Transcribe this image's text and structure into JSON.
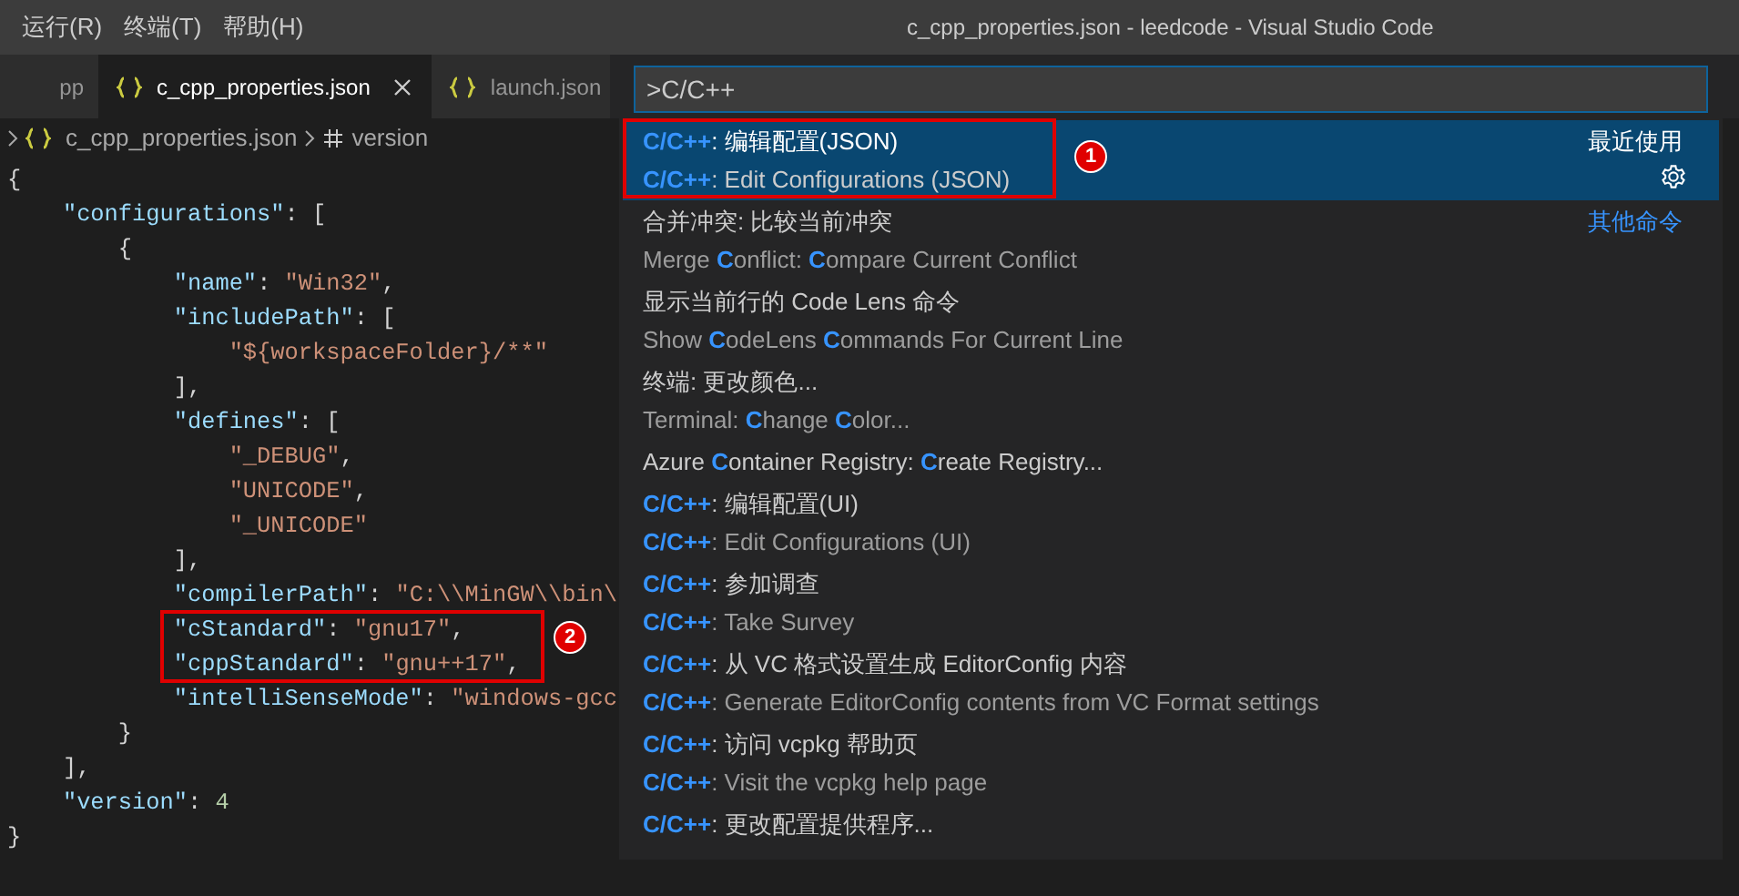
{
  "menu": [
    "运行(R)",
    "终端(T)",
    "帮助(H)"
  ],
  "window": {
    "title": "c_cpp_properties.json - leedcode - Visual Studio Code"
  },
  "tabs": [
    {
      "label": "pp",
      "selected": false,
      "closable": false
    },
    {
      "label": "c_cpp_properties.json",
      "selected": true,
      "closable": true
    },
    {
      "label": "launch.json",
      "selected": false,
      "closable": false
    }
  ],
  "breadcrumb": {
    "file": "c_cpp_properties.json",
    "symbol": "version"
  },
  "editor": {
    "callout": "2",
    "lines": [
      [
        {
          "kind": "punct",
          "text": "{"
        }
      ],
      [
        {
          "kind": "key",
          "text": "    \"configurations\""
        },
        {
          "kind": "punct",
          "text": ": ["
        }
      ],
      [
        {
          "kind": "punct",
          "text": "        {"
        }
      ],
      [
        {
          "kind": "key",
          "text": "            \"name\""
        },
        {
          "kind": "punct",
          "text": ": "
        },
        {
          "kind": "string",
          "text": "\"Win32\""
        },
        {
          "kind": "punct",
          "text": ","
        }
      ],
      [
        {
          "kind": "key",
          "text": "            \"includePath\""
        },
        {
          "kind": "punct",
          "text": ": ["
        }
      ],
      [
        {
          "kind": "string",
          "text": "                \"${workspaceFolder}/**\""
        }
      ],
      [
        {
          "kind": "punct",
          "text": "            ],"
        }
      ],
      [
        {
          "kind": "key",
          "text": "            \"defines\""
        },
        {
          "kind": "punct",
          "text": ": ["
        }
      ],
      [
        {
          "kind": "string",
          "text": "                \"_DEBUG\""
        },
        {
          "kind": "punct",
          "text": ","
        }
      ],
      [
        {
          "kind": "string",
          "text": "                \"UNICODE\""
        },
        {
          "kind": "punct",
          "text": ","
        }
      ],
      [
        {
          "kind": "string",
          "text": "                \"_UNICODE\""
        }
      ],
      [
        {
          "kind": "punct",
          "text": "            ],"
        }
      ],
      [
        {
          "kind": "key",
          "text": "            \"compilerPath\""
        },
        {
          "kind": "punct",
          "text": ": "
        },
        {
          "kind": "string",
          "text": "\"C:\\\\MinGW\\\\bin\\"
        }
      ],
      [
        {
          "kind": "key",
          "text": "            \"cStandard\""
        },
        {
          "kind": "punct",
          "text": ": "
        },
        {
          "kind": "string",
          "text": "\"gnu17\""
        },
        {
          "kind": "punct",
          "text": ","
        }
      ],
      [
        {
          "kind": "key",
          "text": "            \"cppStandard\""
        },
        {
          "kind": "punct",
          "text": ": "
        },
        {
          "kind": "string",
          "text": "\"gnu++17\""
        },
        {
          "kind": "punct",
          "text": ","
        }
      ],
      [
        {
          "kind": "key",
          "text": "            \"intelliSenseMode\""
        },
        {
          "kind": "punct",
          "text": ": "
        },
        {
          "kind": "string",
          "text": "\"windows-gcc"
        }
      ],
      [
        {
          "kind": "punct",
          "text": "        }"
        }
      ],
      [
        {
          "kind": "punct",
          "text": "    ],"
        }
      ],
      [
        {
          "kind": "key",
          "text": "    \"version\""
        },
        {
          "kind": "punct",
          "text": ": "
        },
        {
          "kind": "number",
          "text": "4"
        }
      ],
      [
        {
          "kind": "punct",
          "text": "}"
        }
      ]
    ]
  },
  "palette": {
    "query": ">C/C++",
    "items": [
      {
        "primary": "**C/C++**: 编辑配置(JSON)",
        "secondary": "**C/C++**: Edit Configurations (JSON)",
        "selected": true,
        "tag": "最近使用",
        "gear": true,
        "callout": "1"
      },
      {
        "primary": "合并冲突: 比较当前冲突",
        "secondary": "Merge **C**onflict: **C**ompare Current Conflict",
        "selected": false,
        "tag": "其他命令",
        "gear": false
      },
      {
        "primary": "显示当前行的 Code Lens 命令",
        "secondary": "Show **C**odeLens **C**ommands For Current Line",
        "selected": false,
        "gear": false
      },
      {
        "primary": "终端: 更改颜色...",
        "secondary": "Terminal: **C**hange **C**olor...",
        "selected": false,
        "gear": false
      },
      {
        "primary": "Azure **C**ontainer Registry: **C**reate Registry...",
        "selected": false,
        "gear": false
      },
      {
        "primary": "**C/C++**: 编辑配置(UI)",
        "secondary": "**C/C++**: Edit Configurations (UI)",
        "selected": false,
        "gear": false
      },
      {
        "primary": "**C/C++**: 参加调查",
        "secondary": "**C/C++**: Take Survey",
        "selected": false,
        "gear": false
      },
      {
        "primary": "**C/C++**: 从 VC 格式设置生成 EditorConfig 内容",
        "secondary": "**C/C++**: Generate EditorConfig contents from VC Format settings",
        "selected": false,
        "gear": false
      },
      {
        "primary": "**C/C++**: 访问 vcpkg 帮助页",
        "secondary": "**C/C++**: Visit the vcpkg help page",
        "selected": false,
        "gear": false
      },
      {
        "primary": "**C/C++**: 更改配置提供程序...",
        "selected": false,
        "gear": false
      }
    ]
  }
}
